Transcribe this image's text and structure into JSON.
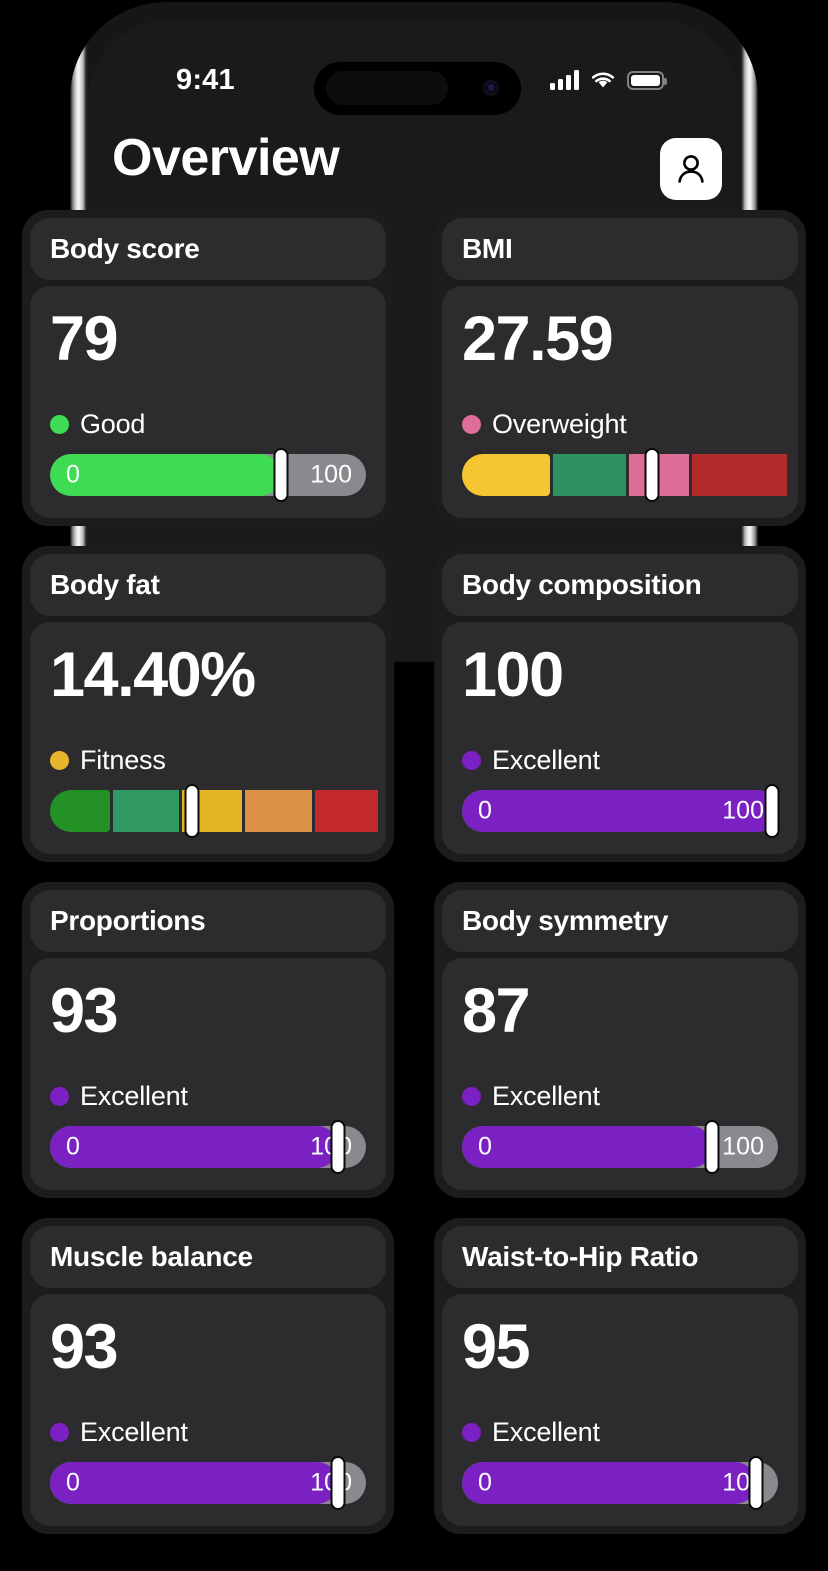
{
  "status_bar": {
    "time": "9:41",
    "cellular_icon": "cellular-bars-icon",
    "wifi_icon": "wifi-icon",
    "battery_icon": "battery-icon"
  },
  "header": {
    "title": "Overview",
    "profile_icon": "person-icon"
  },
  "colors": {
    "green": "#3ddc52",
    "purple": "#7b21c4",
    "pink": "#de6d98",
    "amber": "#e8b62a",
    "track": "#8a8a8e",
    "card_bg": "#1c1c1e",
    "panel_bg": "#2c2c2e"
  },
  "cards": [
    {
      "title": "Body score",
      "value": "79",
      "status": "Good",
      "dot_color": "#3ddc52",
      "gauge": {
        "type": "progress",
        "min_label": "0",
        "max_label": "100",
        "fill_color": "#3ddc52",
        "fill_pct": 73,
        "marker_pct": 73
      }
    },
    {
      "title": "BMI",
      "value": "27.59",
      "status": "Overweight",
      "dot_color": "#de6d98",
      "gauge": {
        "type": "segmented",
        "marker_pct": 60,
        "segments": [
          {
            "color": "#f5c632",
            "width_pct": 28
          },
          {
            "color": "#2e9160",
            "width_pct": 23
          },
          {
            "color": "#de6d98",
            "width_pct": 19
          },
          {
            "color": "#b32a2a",
            "width_pct": 30
          }
        ]
      }
    },
    {
      "title": "Body fat",
      "value": "14.40%",
      "status": "Fitness",
      "dot_color": "#e8b62a",
      "gauge": {
        "type": "segmented",
        "marker_pct": 45,
        "segments": [
          {
            "color": "#249127",
            "width_pct": 19
          },
          {
            "color": "#319963",
            "width_pct": 21
          },
          {
            "color": "#e3b522",
            "width_pct": 19
          },
          {
            "color": "#da9046",
            "width_pct": 21
          },
          {
            "color": "#c3282c",
            "width_pct": 20
          }
        ]
      }
    },
    {
      "title": "Body composition",
      "value": "100",
      "status": "Excellent",
      "dot_color": "#7b21c4",
      "gauge": {
        "type": "progress",
        "min_label": "0",
        "max_label": "100",
        "fill_color": "#7b21c4",
        "fill_pct": 100,
        "marker_pct": 98
      }
    },
    {
      "title": "Proportions",
      "value": "93",
      "status": "Excellent",
      "dot_color": "#7b21c4",
      "gauge": {
        "type": "progress",
        "min_label": "0",
        "max_label": "100",
        "fill_color": "#7b21c4",
        "fill_pct": 91,
        "marker_pct": 91
      }
    },
    {
      "title": "Body symmetry",
      "value": "87",
      "status": "Excellent",
      "dot_color": "#7b21c4",
      "gauge": {
        "type": "progress",
        "min_label": "0",
        "max_label": "100",
        "fill_color": "#7b21c4",
        "fill_pct": 79,
        "marker_pct": 79
      }
    },
    {
      "title": "Muscle balance",
      "value": "93",
      "status": "Excellent",
      "dot_color": "#7b21c4",
      "gauge": {
        "type": "progress",
        "min_label": "0",
        "max_label": "100",
        "fill_color": "#7b21c4",
        "fill_pct": 91,
        "marker_pct": 91
      }
    },
    {
      "title": "Waist-to-Hip Ratio",
      "value": "95",
      "status": "Excellent",
      "dot_color": "#7b21c4",
      "gauge": {
        "type": "progress",
        "min_label": "0",
        "max_label": "100",
        "fill_color": "#7b21c4",
        "fill_pct": 93,
        "marker_pct": 93
      }
    }
  ]
}
